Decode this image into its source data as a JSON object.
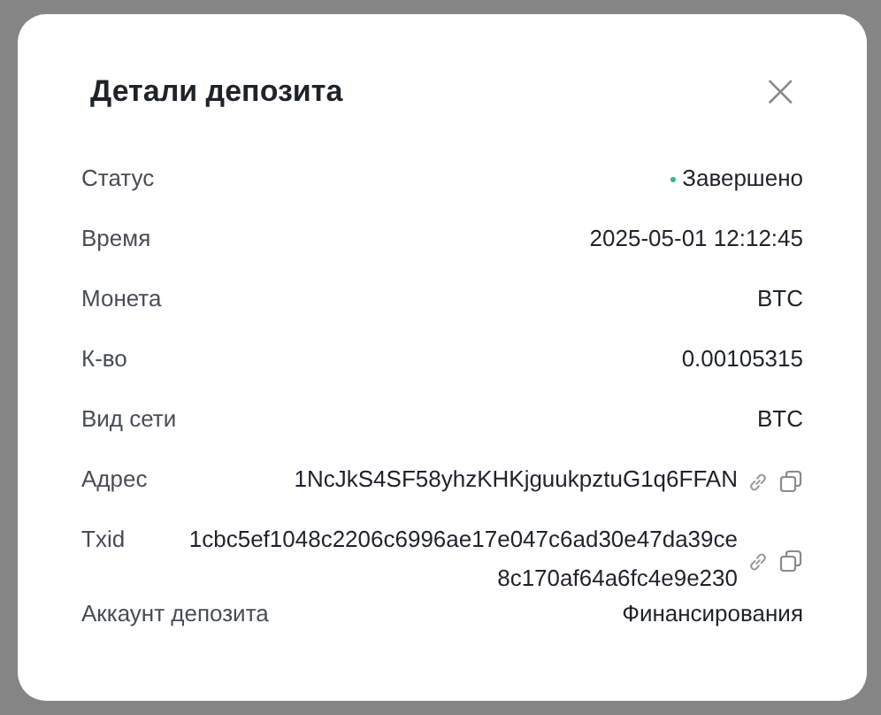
{
  "dialog": {
    "title": "Детали депозита",
    "close": "×"
  },
  "rows": [
    {
      "kind": "status",
      "label": "Статус",
      "value": "Завершено",
      "color": "#2ebd85"
    },
    {
      "kind": "text",
      "label": "Время",
      "value": "2025-05-01 12:12:45"
    },
    {
      "kind": "text",
      "label": "Монета",
      "value": "BTC"
    },
    {
      "kind": "text",
      "label": "К-во",
      "value": "0.00105315"
    },
    {
      "kind": "text",
      "label": "Вид сети",
      "value": "BTC"
    },
    {
      "kind": "copyable",
      "label": "Адрес",
      "value": "1NcJkS4SF58yhzKHKjguukpztuG1q6FFAN"
    },
    {
      "kind": "copyable",
      "label": "Txid",
      "value": "1cbc5ef1048c2206c6996ae17e047c6ad30e47da39ce8c170af64a6fc4e9e230"
    },
    {
      "kind": "text",
      "label": "Аккаунт депозита",
      "value": "Финансирования"
    }
  ]
}
